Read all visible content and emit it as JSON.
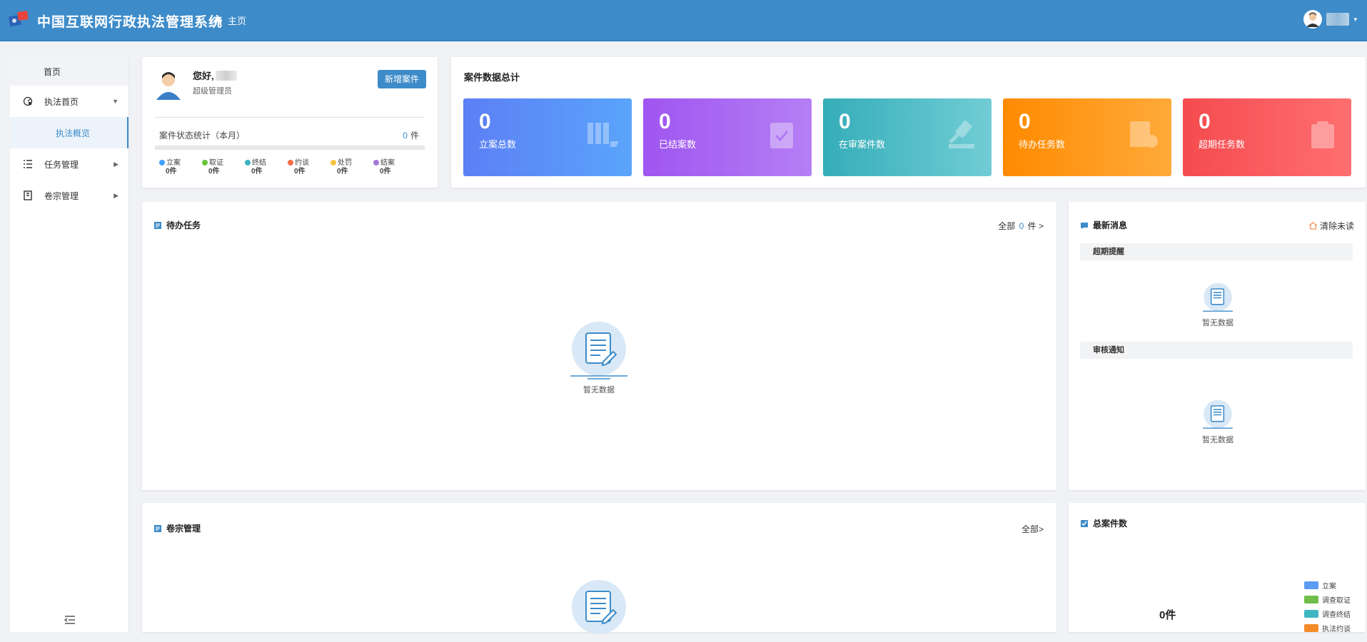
{
  "header": {
    "title": "中国互联网行政执法管理系统",
    "home_label": "主页",
    "colors": {
      "bar": "#3d8bc9"
    }
  },
  "sidebar": {
    "home": "首页",
    "items": [
      {
        "label": "执法首页",
        "icon": "gauge-icon",
        "expanded": true
      },
      {
        "label": "执法概览",
        "selected": true
      },
      {
        "label": "任务管理",
        "icon": "list-icon"
      },
      {
        "label": "卷宗管理",
        "icon": "book-icon"
      }
    ]
  },
  "profile": {
    "greeting": "您好,",
    "role": "超级管理员",
    "new_case_button": "新增案件",
    "stats_title": "案件状态统计（本月）",
    "stats_count": "0",
    "stats_unit": "件",
    "statuses": [
      {
        "label": "立案",
        "count": "0件",
        "color": "#409eff"
      },
      {
        "label": "取证",
        "count": "0件",
        "color": "#67c23a"
      },
      {
        "label": "终结",
        "count": "0件",
        "color": "#3bb1c0"
      },
      {
        "label": "约谈",
        "count": "0件",
        "color": "#f56c45"
      },
      {
        "label": "处罚",
        "count": "0件",
        "color": "#f5c342"
      },
      {
        "label": "结案",
        "count": "0件",
        "color": "#a27ad8"
      }
    ]
  },
  "overview": {
    "title": "案件数据总计",
    "tiles": [
      {
        "value": "0",
        "label": "立案总数",
        "from": "#5c7ff5",
        "to": "#5aa4fb"
      },
      {
        "value": "0",
        "label": "已结案数",
        "from": "#9f55f0",
        "to": "#b57ff4"
      },
      {
        "value": "0",
        "label": "在审案件数",
        "from": "#35adb9",
        "to": "#71cdd5"
      },
      {
        "value": "0",
        "label": "待办任务数",
        "from": "#ff8a00",
        "to": "#ffaa3a"
      },
      {
        "value": "0",
        "label": "超期任务数",
        "from": "#f54b4f",
        "to": "#ff6f70"
      }
    ]
  },
  "todo": {
    "title": "待办任务",
    "all_label": "全部",
    "count": "0",
    "unit": "件 >",
    "empty_text": "暂无数据"
  },
  "news": {
    "title": "最新消息",
    "clear_label": "清除未读",
    "overdue_title": "超期提醒",
    "overdue_empty": "暂无数据",
    "review_title": "审核通知",
    "review_empty": "暂无数据"
  },
  "archive": {
    "title": "卷宗管理",
    "all_label": "全部>"
  },
  "total": {
    "title": "总案件数",
    "count_text": "0件",
    "legend": [
      {
        "label": "立案",
        "color": "#5b9cf5"
      },
      {
        "label": "调查取证",
        "color": "#6fbd4a"
      },
      {
        "label": "调查终结",
        "color": "#3fb7c2"
      },
      {
        "label": "执法约谈",
        "color": "#f58a2a"
      }
    ]
  }
}
